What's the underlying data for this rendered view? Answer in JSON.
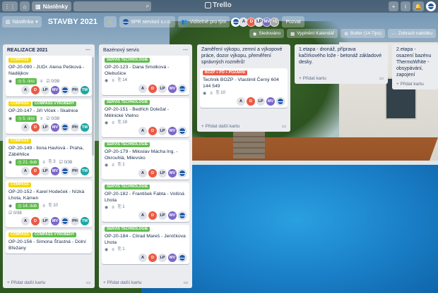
{
  "topbar": {
    "board_button": "Nástěnky",
    "logo": "Trello",
    "add_icon": "+",
    "info_icon": "i",
    "bell_icon": "🔔"
  },
  "header": {
    "board_select": "Nástěnka",
    "title": "STAVBY 2021",
    "team": "SPR servisní s.r.o.",
    "visibility": "Viditelné pro tým",
    "extra_members": "+1",
    "invite": "Pozvat",
    "members": [
      "A",
      "D",
      "LP",
      "MV"
    ]
  },
  "menubar": {
    "tracking": "Sledováno",
    "calendar": "Vyplnění Kalendář",
    "butler": "Butler (14 Tips)",
    "menu": "Zobrazit nabídku"
  },
  "lists": [
    {
      "title": "REALIZACE 2021",
      "add_card": "Přidat další kartu",
      "cards": [
        {
          "labels": [
            {
              "text": "COMPASS",
              "color": "yellow"
            }
          ],
          "title": "OP-20-090 - JUDr. Alena Pešková - Nadějkov",
          "due": "5. úno",
          "checklist": "0/38",
          "avatars": [
            "A",
            "D",
            "LP",
            "MV",
            "logo",
            "PH",
            "TM"
          ]
        },
        {
          "labels": [
            {
              "text": "COMPASS",
              "color": "yellow"
            },
            {
              "text": "COMPASS VYROBENÝ",
              "color": "green"
            }
          ],
          "title": "OP-20-147 - Jiří Vlček - Skalnice",
          "due": "5. úno",
          "checklist": "0/38",
          "avatars": [
            "A",
            "D",
            "LP",
            "MV",
            "logo",
            "PH",
            "TM"
          ]
        },
        {
          "labels": [
            {
              "text": "COMPASS",
              "color": "yellow"
            }
          ],
          "title": "OP-20-149 - Ilona Havlová - Praha, Záběhlice",
          "due": "21. dub",
          "attachments": "3",
          "checklist": "0/38",
          "avatars": [
            "A",
            "D",
            "LP",
            "MV",
            "logo",
            "PH",
            "TM"
          ]
        },
        {
          "labels": [
            {
              "text": "COMPASS",
              "color": "yellow"
            }
          ],
          "title": "OP-20-152 - Karel Hodeček - Nízká Lhota, Kámen",
          "due": "14. dub",
          "attachments": "10",
          "checklist": "0/38",
          "avatars": [
            "A",
            "D",
            "LP",
            "MV",
            "logo",
            "PH",
            "TM"
          ]
        },
        {
          "labels": [
            {
              "text": "COMPASS",
              "color": "yellow"
            },
            {
              "text": "COMPASS VYROBENÝ",
              "color": "green"
            }
          ],
          "title": "OP-20-156 - Simona Šťastná - Dolní Břežany"
        }
      ]
    },
    {
      "title": "Bazénový servis",
      "add_card": "Přidat další kartu",
      "cards": [
        {
          "labels": [
            {
              "text": "SERVIS TECHNOLOGIE",
              "color": "green"
            }
          ],
          "title": "OP-20-123 - Dana Smolková - Olebušice",
          "attachments": "14",
          "avatars": [
            "A",
            "D",
            "LP",
            "MV",
            "logo"
          ]
        },
        {
          "labels": [
            {
              "text": "SERVIS TECHNOLOGIE",
              "color": "green"
            }
          ],
          "title": "OP-20-151 - Bedřich Doležal - Mělnické Vtelno",
          "attachments": "19",
          "avatars": [
            "A",
            "D",
            "LP",
            "MV",
            "logo"
          ]
        },
        {
          "labels": [
            {
              "text": "SERVIS TECHNOLOGIE",
              "color": "green"
            }
          ],
          "title": "OP-20-179 - Miloslav Mácha Ing. - Okrouhlá, Milevsko",
          "attachments": "1",
          "avatars": [
            "A",
            "D",
            "LP",
            "MV",
            "logo"
          ]
        },
        {
          "labels": [
            {
              "text": "SERVIS TECHNOLOGIE",
              "color": "green"
            }
          ],
          "title": "OP-20-182 - František Fabta - Volšná Lhota",
          "attachments": "1",
          "avatars": [
            "A",
            "D",
            "LP",
            "MV",
            "logo"
          ]
        },
        {
          "labels": [
            {
              "text": "SERVIS TECHNOLOGIE",
              "color": "green"
            }
          ],
          "title": "OP-20-184 - Ctirad Mareš - Jeníčkova Lhota",
          "attachments": "1",
          "avatars": [
            "A",
            "D",
            "LP",
            "MV",
            "logo"
          ]
        }
      ]
    },
    {
      "title": "Zaměření výkopu, zemní a výkopové práce, dozor výkopu, přeměření správných rozměrů!",
      "add_card": "Přidat další kartu",
      "cards": [
        {
          "labels": [
            {
              "text": "BOZP + PO + POŽÁRNÍ",
              "color": "red"
            }
          ],
          "title": "Technik BOZP - Vlastimil Černý 604 144 549",
          "attachments": "10",
          "avatars": [
            "A",
            "D",
            "LP",
            "MV",
            "logo"
          ]
        }
      ]
    },
    {
      "title": "1.etapa - dronáž, příprava kačírkového lože - betonáž základové desky.",
      "add_card": "Přidat kartu"
    },
    {
      "title": "2.etapa - osazení bazénu ThermoWhite - obsypávání, zapojení technologie, tlakové zkoušky!",
      "add_card": "Přidat kartu"
    }
  ]
}
